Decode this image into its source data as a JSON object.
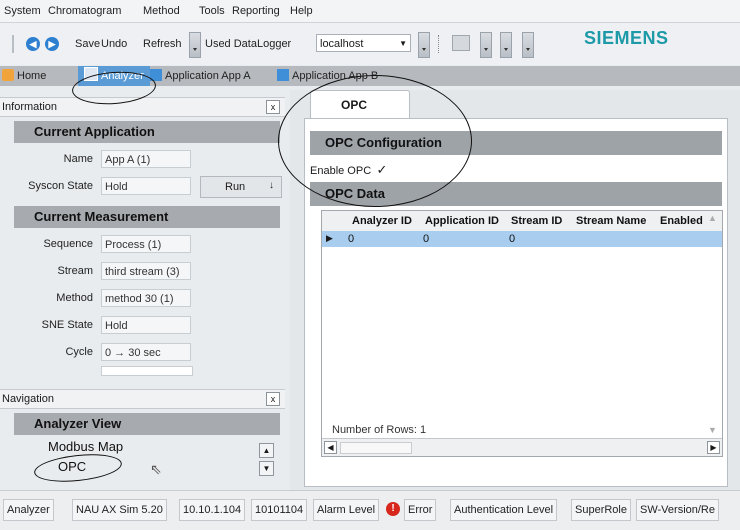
{
  "menu": {
    "items": [
      "System",
      "Chromatogram",
      "Method",
      "Tools",
      "Reporting",
      "Help"
    ]
  },
  "toolbar": {
    "save_label": "Save",
    "undo_label": "Undo",
    "refresh_label": "Refresh",
    "datalogger_label": "Used DataLogger",
    "datalogger_value": "localhost"
  },
  "brand": {
    "logo_text": "SIEMENS",
    "logo_color": "#1d9aa8"
  },
  "tabs": {
    "home": "Home",
    "analyzer": "Analyzer",
    "app_a": "Application App A",
    "app_b": "Application App B"
  },
  "information": {
    "title": "Information",
    "current_application": "Current Application",
    "name_label": "Name",
    "name_value": "App A (1)",
    "syscon_label": "Syscon State",
    "syscon_value": "Hold",
    "run_label": "Run",
    "current_measurement": "Current Measurement",
    "sequence_label": "Sequence",
    "sequence_value": "Process (1)",
    "stream_label": "Stream",
    "stream_value": "third stream (3)",
    "method_label": "Method",
    "method_value": "method 30 (1)",
    "sne_label": "SNE State",
    "sne_value": "Hold",
    "cycle_label": "Cycle",
    "cycle_value": "0 → 30 sec"
  },
  "navigation": {
    "title": "Navigation",
    "section": "Analyzer View",
    "items": [
      "Modbus Map",
      "OPC"
    ]
  },
  "opc": {
    "tab_label": "OPC",
    "config_title": "OPC Configuration",
    "enable_label": "Enable OPC",
    "enable_checked": true,
    "data_title": "OPC Data",
    "columns": [
      "Analyzer ID",
      "Application ID",
      "Stream ID",
      "Stream Name",
      "Enabled"
    ],
    "rows": [
      [
        "0",
        "0",
        "0",
        "",
        ""
      ]
    ],
    "row_count_text": "Number of Rows: 1",
    "selected_row_color": "#a9cdee"
  },
  "status": {
    "items": [
      "Analyzer",
      "NAU AX Sim 5.20",
      "10.10.1.104",
      "10101104",
      "Alarm Level",
      "Error",
      "Authentication Level",
      "SuperRole",
      "SW-Version/Re"
    ],
    "error_color": "#d7261c"
  }
}
